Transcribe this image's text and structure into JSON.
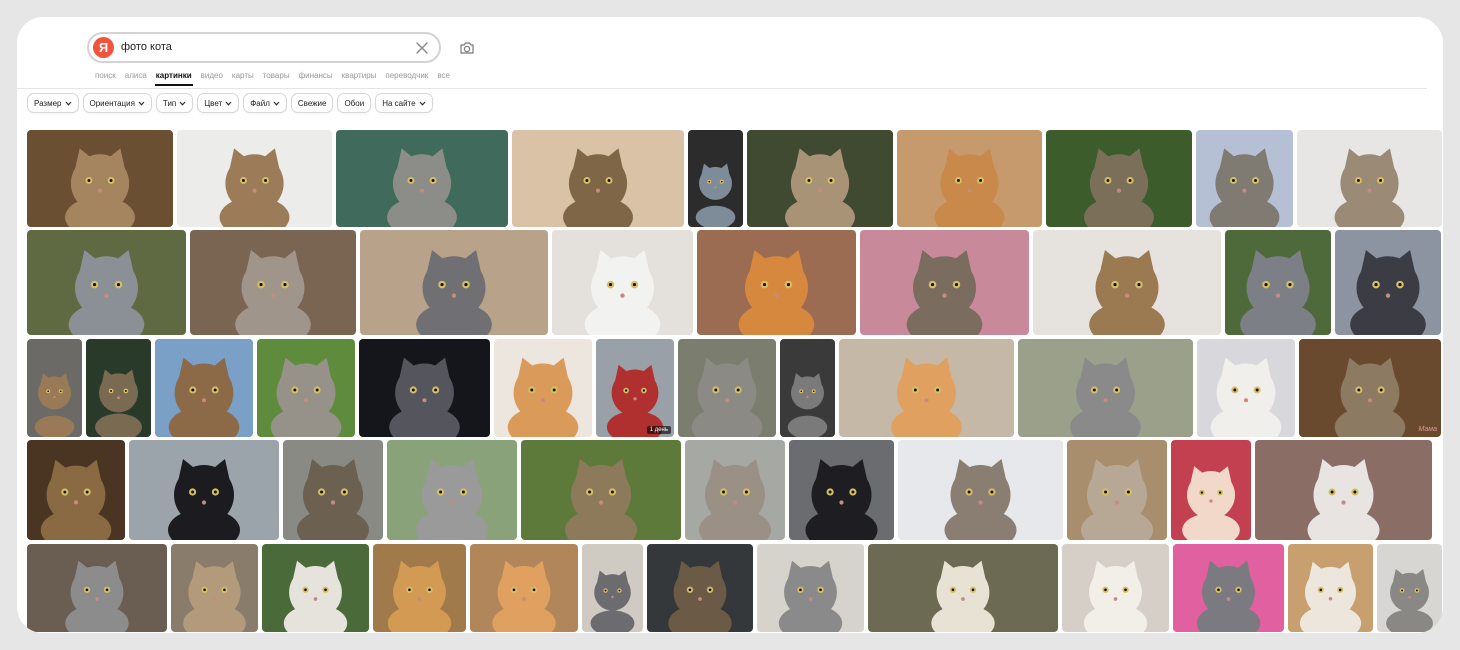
{
  "search": {
    "query": "фото кота",
    "logo_letter": "Я"
  },
  "services": [
    {
      "label": "поиск",
      "active": false
    },
    {
      "label": "алиса",
      "active": false
    },
    {
      "label": "картинки",
      "active": true
    },
    {
      "label": "видео",
      "active": false
    },
    {
      "label": "карты",
      "active": false
    },
    {
      "label": "товары",
      "active": false
    },
    {
      "label": "финансы",
      "active": false
    },
    {
      "label": "квартиры",
      "active": false
    },
    {
      "label": "переводчик",
      "active": false
    },
    {
      "label": "все",
      "active": false
    }
  ],
  "filters": [
    {
      "label": "Размер",
      "dropdown": true
    },
    {
      "label": "Ориентация",
      "dropdown": true
    },
    {
      "label": "Тип",
      "dropdown": true
    },
    {
      "label": "Цвет",
      "dropdown": true
    },
    {
      "label": "Файл",
      "dropdown": true
    },
    {
      "label": "Свежие",
      "dropdown": false
    },
    {
      "label": "Обои",
      "dropdown": false
    },
    {
      "label": "На сайте",
      "dropdown": true
    }
  ],
  "colors": {
    "brand": "#f2533f",
    "active_tab": "#111111"
  },
  "results": [
    [
      {
        "bg": "#6b4f33",
        "cat": "#a58460"
      },
      {
        "bg": "#ececea",
        "cat": "#9c7c58"
      },
      {
        "bg": "#3f6a5c",
        "cat": "#8c8c88"
      },
      {
        "bg": "#d9c2a6",
        "cat": "#7e6646"
      },
      {
        "bg": "#2c2c2c",
        "cat": "#7d8c98"
      },
      {
        "bg": "#3f4a30",
        "cat": "#a89376"
      },
      {
        "bg": "#c79a6d",
        "cat": "#c9894a"
      },
      {
        "bg": "#3c5c2c",
        "cat": "#7c6f5a"
      },
      {
        "bg": "#b6c0d4",
        "cat": "#7f7a72"
      },
      {
        "bg": "#e8e6e4",
        "cat": "#9a8a76"
      }
    ],
    [
      {
        "bg": "#5f6a42",
        "cat": "#8b8f96"
      },
      {
        "bg": "#7a6452",
        "cat": "#a0958a"
      },
      {
        "bg": "#b9a28a",
        "cat": "#6f6f74"
      },
      {
        "bg": "#e4e0dc",
        "cat": "#f2f2f0"
      },
      {
        "bg": "#9b6b52",
        "cat": "#d6883e"
      },
      {
        "bg": "#c88a9a",
        "cat": "#7a6c5e"
      },
      {
        "bg": "#e6e2de",
        "cat": "#9b7a52"
      },
      {
        "bg": "#4f6a3a",
        "cat": "#7c7f86"
      },
      {
        "bg": "#8c94a2",
        "cat": "#3c3c44"
      }
    ],
    [
      {
        "bg": "#6c6a66",
        "cat": "#9a7a56"
      },
      {
        "bg": "#2a3a2a",
        "cat": "#7a6a52"
      },
      {
        "bg": "#7aa0c8",
        "cat": "#8c6a48"
      },
      {
        "bg": "#5f8c3c",
        "cat": "#96928a"
      },
      {
        "bg": "#15151c",
        "cat": "#55555e"
      },
      {
        "bg": "#ece6de",
        "cat": "#d99a5a"
      },
      {
        "bg": "#9aa0a8",
        "cat": "#b03030",
        "badge": "1 день"
      },
      {
        "bg": "#7b7d6e",
        "cat": "#8c8a84"
      },
      {
        "bg": "#3a3a3a",
        "cat": "#7a7a7a"
      },
      {
        "bg": "#c6b8a6",
        "cat": "#e0a060"
      },
      {
        "bg": "#9aa08a",
        "cat": "#8a8a8a"
      },
      {
        "bg": "#d8d8dc",
        "cat": "#f0efec"
      },
      {
        "bg": "#6a4a2e",
        "cat": "#8c7a62",
        "watermark": "Мама"
      }
    ],
    [
      {
        "bg": "#4a3422",
        "cat": "#8a6a42"
      },
      {
        "bg": "#9aa4aa",
        "cat": "#1c1c20"
      },
      {
        "bg": "#8a8a84",
        "cat": "#6c6050"
      },
      {
        "bg": "#8aa27a",
        "cat": "#9a9a9a"
      },
      {
        "bg": "#5e7a3a",
        "cat": "#8c7a5a"
      },
      {
        "bg": "#a6a8a4",
        "cat": "#9a9086"
      },
      {
        "bg": "#6a6c70",
        "cat": "#1e1e22"
      },
      {
        "bg": "#e6e8ec",
        "cat": "#8a7e72"
      },
      {
        "bg": "#a98e6e",
        "cat": "#b7a896"
      },
      {
        "bg": "#c24050",
        "cat": "#f2d8c8"
      },
      {
        "bg": "#8a6e66",
        "cat": "#e8e4e2"
      }
    ],
    [
      {
        "bg": "#6a5e52",
        "cat": "#8c8c8c"
      },
      {
        "bg": "#8a7c6a",
        "cat": "#b29a7a"
      },
      {
        "bg": "#4a6a3a",
        "cat": "#e6e2dc"
      },
      {
        "bg": "#a07a4a",
        "cat": "#d29a52"
      },
      {
        "bg": "#b0865a",
        "cat": "#e0a060"
      },
      {
        "bg": "#cfcac2",
        "cat": "#6c6c70"
      },
      {
        "bg": "#34383a",
        "cat": "#6a5a46"
      },
      {
        "bg": "#d6d2cc",
        "cat": "#8a8a8a"
      },
      {
        "bg": "#6c6a52",
        "cat": "#e8e2d4"
      },
      {
        "bg": "#d6cfc8",
        "cat": "#f2eee8"
      },
      {
        "bg": "#e060a0",
        "cat": "#7a7a80"
      },
      {
        "bg": "#c8a070",
        "cat": "#ece6dc"
      },
      {
        "bg": "#d8d6d2",
        "cat": "#8a8884"
      }
    ]
  ]
}
